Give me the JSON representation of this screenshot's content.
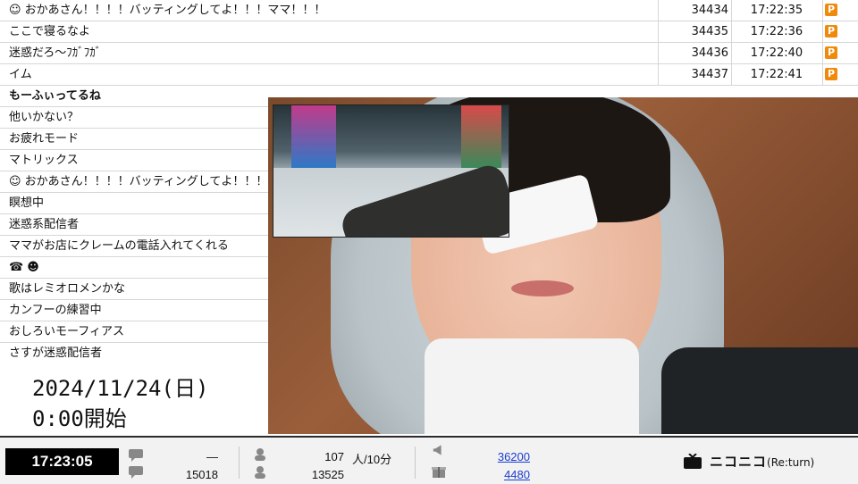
{
  "comments": [
    {
      "icon": "face-icon",
      "text": "おかあさん！！！！バッティングしてよ！！！ママ！！！",
      "bold": false,
      "num": "34434",
      "time": "17:22:35",
      "premium": true
    },
    {
      "icon": "",
      "text": "ここで寝るなよ",
      "bold": false,
      "num": "34435",
      "time": "17:22:36",
      "premium": true
    },
    {
      "icon": "",
      "text": "迷惑だろ～ﾌｶﾞﾌｶﾞ",
      "bold": false,
      "num": "34436",
      "time": "17:22:40",
      "premium": true
    },
    {
      "icon": "",
      "text": "イム",
      "bold": false,
      "num": "34437",
      "time": "17:22:41",
      "premium": true
    },
    {
      "icon": "",
      "text": "もーふぃってるね",
      "bold": true,
      "num": "",
      "time": "",
      "premium": false
    },
    {
      "icon": "",
      "text": "他いかない？",
      "bold": false,
      "num": "",
      "time": "",
      "premium": false
    },
    {
      "icon": "",
      "text": "お疲れモード",
      "bold": false,
      "num": "",
      "time": "",
      "premium": false
    },
    {
      "icon": "",
      "text": "マトリックス",
      "bold": false,
      "num": "",
      "time": "",
      "premium": false
    },
    {
      "icon": "face-icon",
      "text": "おかあさん！！！！バッティングしてよ！！！",
      "bold": false,
      "num": "",
      "time": "",
      "premium": false
    },
    {
      "icon": "",
      "text": "瞑想中",
      "bold": false,
      "num": "",
      "time": "",
      "premium": false
    },
    {
      "icon": "",
      "text": "迷惑系配信者",
      "bold": false,
      "num": "",
      "time": "",
      "premium": false
    },
    {
      "icon": "",
      "text": "ママがお店にクレームの電話入れてくれる",
      "bold": false,
      "num": "",
      "time": "",
      "premium": false
    },
    {
      "icon": "phone-alien-icon",
      "text": "",
      "bold": false,
      "num": "",
      "time": "",
      "premium": false
    },
    {
      "icon": "",
      "text": "歌はレミオロメンかな",
      "bold": false,
      "num": "",
      "time": "",
      "premium": false
    },
    {
      "icon": "",
      "text": "カンフーの練習中",
      "bold": false,
      "num": "",
      "time": "",
      "premium": false
    },
    {
      "icon": "",
      "text": "おしろいモーフィアス",
      "bold": false,
      "num": "",
      "time": "",
      "premium": false
    },
    {
      "icon": "",
      "text": "さすが迷惑配信者",
      "bold": false,
      "num": "",
      "time": "",
      "premium": false
    }
  ],
  "premium_badge": "P",
  "overlay": {
    "date": "2024/11/24(日)",
    "start": "0:00開始"
  },
  "statusbar": {
    "clock": "17:23:05",
    "comments_top": "—",
    "comments_total": "15018",
    "viewers_rate": "107",
    "viewers_rate_unit": "人/10分",
    "viewers_total": "13525",
    "ad_points": "36200",
    "gift_points": "4480"
  },
  "logo": {
    "name": "ニコニコ",
    "suffix": "(Re:turn)"
  },
  "colors": {
    "premium": "#f08a0c",
    "link": "#1a3ccf",
    "clock_bg": "#000000"
  }
}
